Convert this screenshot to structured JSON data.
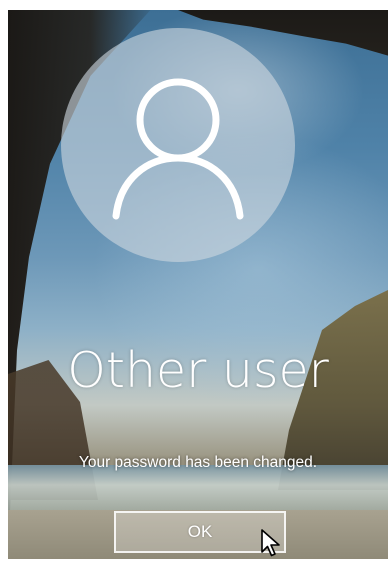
{
  "user": {
    "name": "Other user",
    "avatar_icon": "user-silhouette-icon"
  },
  "message": {
    "text": "Your password has been changed."
  },
  "actions": {
    "ok_label": "OK"
  },
  "pointer": {
    "icon": "mouse-cursor-icon"
  },
  "colors": {
    "text": "#ffffff",
    "avatar_circle": "#cdd7de"
  }
}
